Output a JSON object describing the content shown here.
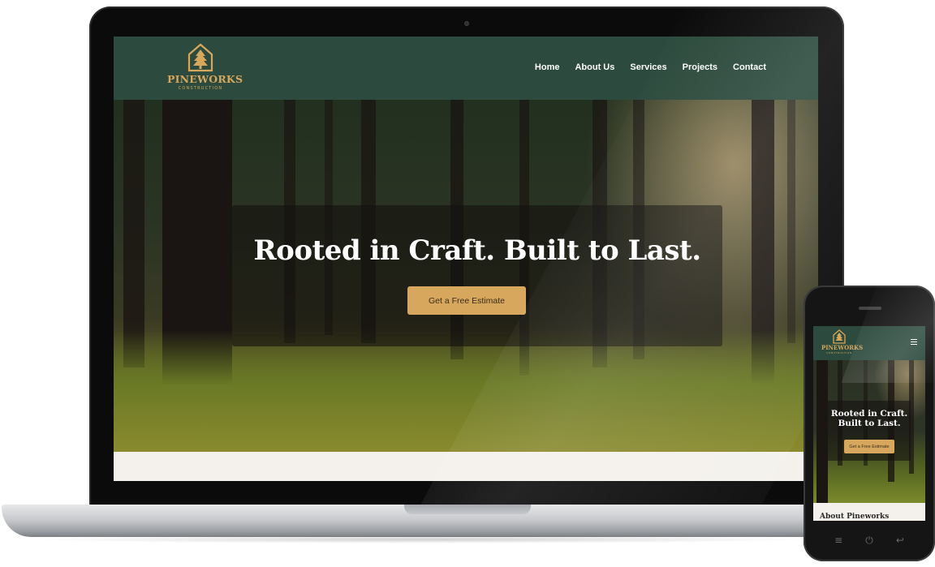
{
  "desktop": {
    "logo": {
      "name": "PINEWORKS",
      "tagline": "CONSTRUCTION"
    },
    "nav": [
      "Home",
      "About Us",
      "Services",
      "Projects",
      "Contact"
    ],
    "hero": {
      "title": "Rooted in Craft. Built to Last.",
      "cta_label": "Get a Free Estimate"
    }
  },
  "mobile": {
    "logo": {
      "name": "PINEWORKS",
      "tagline": "CONSTRUCTION"
    },
    "hero": {
      "title_line1": "Rooted in Craft.",
      "title_line2": "Built to Last.",
      "cta_label": "Get a Free Estimate"
    },
    "section_heading": "About Pineworks",
    "device_buttons": [
      "≡",
      "⏻",
      "↩"
    ]
  },
  "colors": {
    "header_green": "#2c4a3d",
    "brand_gold": "#d6a75c",
    "page_bg": "#f4f1ec"
  },
  "icons": {
    "logo": "pine-tree-house-icon",
    "mobile_menu": "hamburger-menu-icon"
  }
}
